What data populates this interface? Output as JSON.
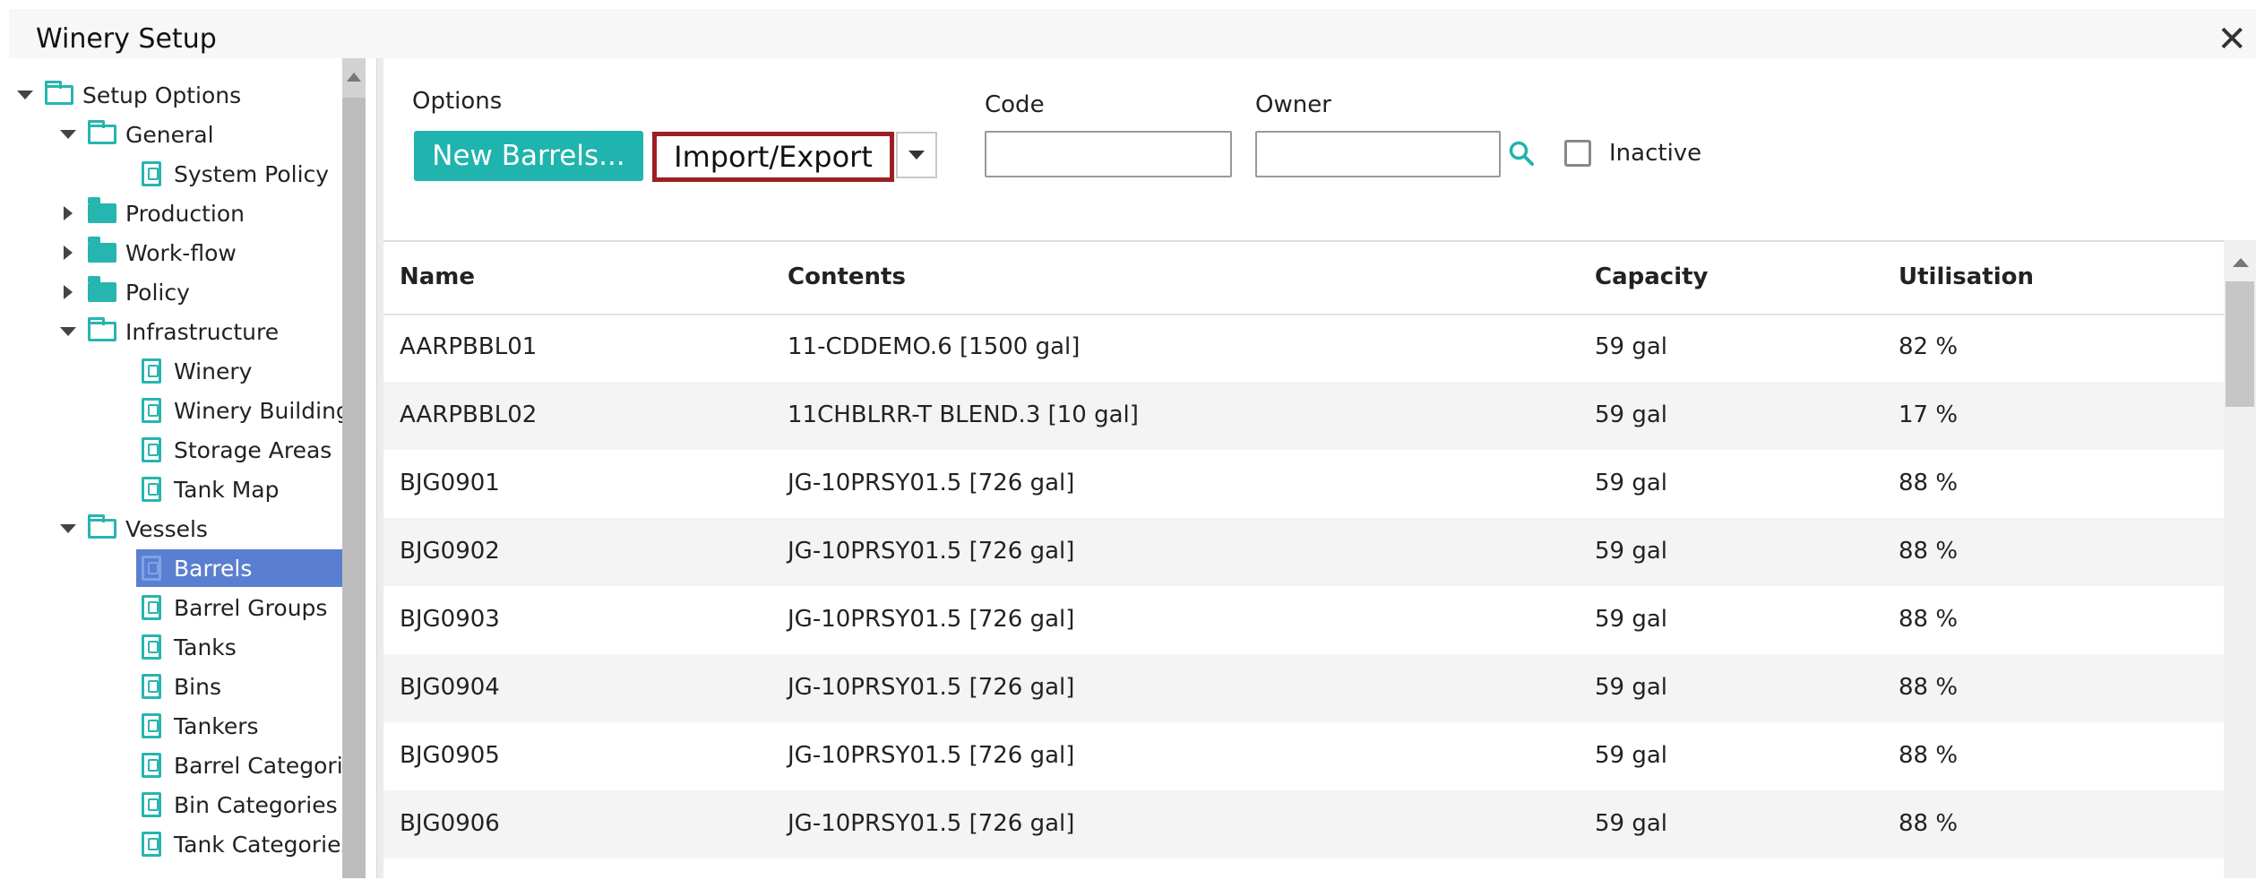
{
  "window": {
    "title": "Winery Setup",
    "close_glyph": "✕"
  },
  "sidebar": {
    "items": [
      {
        "label": "Setup Options",
        "icon": "folder-open-icon",
        "toggle": "expanded",
        "level": 0
      },
      {
        "label": "General",
        "icon": "folder-open-icon",
        "toggle": "expanded",
        "level": 1
      },
      {
        "label": "System Policy",
        "icon": "document-icon",
        "toggle": "none",
        "level": 2
      },
      {
        "label": "Production",
        "icon": "folder-icon",
        "toggle": "collapsed",
        "level": 1
      },
      {
        "label": "Work-flow",
        "icon": "folder-icon",
        "toggle": "collapsed",
        "level": 1
      },
      {
        "label": "Policy",
        "icon": "folder-icon",
        "toggle": "collapsed",
        "level": 1
      },
      {
        "label": "Infrastructure",
        "icon": "folder-open-icon",
        "toggle": "expanded",
        "level": 1
      },
      {
        "label": "Winery",
        "icon": "document-icon",
        "toggle": "none",
        "level": 2
      },
      {
        "label": "Winery Building",
        "icon": "document-icon",
        "toggle": "none",
        "level": 2
      },
      {
        "label": "Storage Areas",
        "icon": "document-icon",
        "toggle": "none",
        "level": 2
      },
      {
        "label": "Tank Map",
        "icon": "document-icon",
        "toggle": "none",
        "level": 2
      },
      {
        "label": "Vessels",
        "icon": "folder-open-icon",
        "toggle": "expanded",
        "level": 1
      },
      {
        "label": "Barrels",
        "icon": "document-icon",
        "toggle": "none",
        "level": 2,
        "selected": true
      },
      {
        "label": "Barrel Groups",
        "icon": "document-icon",
        "toggle": "none",
        "level": 2
      },
      {
        "label": "Tanks",
        "icon": "document-icon",
        "toggle": "none",
        "level": 2
      },
      {
        "label": "Bins",
        "icon": "document-icon",
        "toggle": "none",
        "level": 2
      },
      {
        "label": "Tankers",
        "icon": "document-icon",
        "toggle": "none",
        "level": 2
      },
      {
        "label": "Barrel Categori",
        "icon": "document-icon",
        "toggle": "none",
        "level": 2
      },
      {
        "label": "Bin Categories",
        "icon": "document-icon",
        "toggle": "none",
        "level": 2
      },
      {
        "label": "Tank Categories",
        "icon": "document-icon",
        "toggle": "none",
        "level": 2
      }
    ]
  },
  "toolbar": {
    "options_label": "Options",
    "new_barrels_label": "New Barrels...",
    "import_export_label": "Import/Export",
    "code_label": "Code",
    "code_value": "",
    "owner_label": "Owner",
    "owner_value": "",
    "inactive_label": "Inactive",
    "inactive_checked": false
  },
  "table": {
    "columns": [
      "Name",
      "Contents",
      "Capacity",
      "Utilisation"
    ],
    "rows": [
      [
        "AARPBBL01",
        "11-CDDEMO.6 [1500 gal]",
        "59 gal",
        "82 %"
      ],
      [
        "AARPBBL02",
        "11CHBLRR-T BLEND.3 [10 gal]",
        "59 gal",
        "17 %"
      ],
      [
        "BJG0901",
        "JG-10PRSY01.5 [726 gal]",
        "59 gal",
        "88 %"
      ],
      [
        "BJG0902",
        "JG-10PRSY01.5 [726 gal]",
        "59 gal",
        "88 %"
      ],
      [
        "BJG0903",
        "JG-10PRSY01.5 [726 gal]",
        "59 gal",
        "88 %"
      ],
      [
        "BJG0904",
        "JG-10PRSY01.5 [726 gal]",
        "59 gal",
        "88 %"
      ],
      [
        "BJG0905",
        "JG-10PRSY01.5 [726 gal]",
        "59 gal",
        "88 %"
      ],
      [
        "BJG0906",
        "JG-10PRSY01.5 [726 gal]",
        "59 gal",
        "88 %"
      ]
    ]
  },
  "colors": {
    "accent": "#1fb4ad",
    "highlight_border": "#9c1f26",
    "selected_row": "#5b7fd0"
  }
}
